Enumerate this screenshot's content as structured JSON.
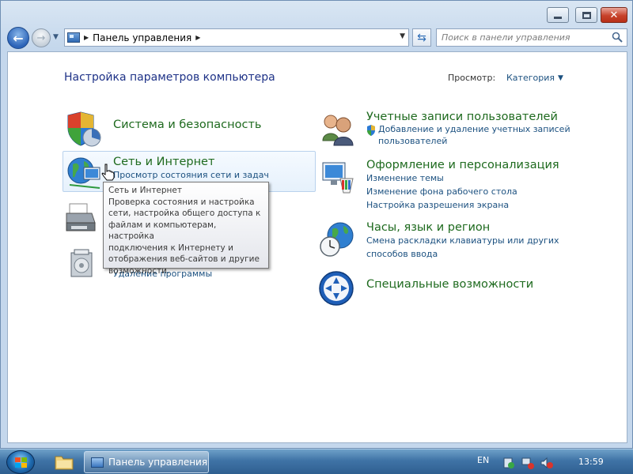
{
  "window": {
    "min_label": "minimize",
    "max_label": "maximize",
    "close_label": "close"
  },
  "nav": {
    "address_text": "Панель управления",
    "search_placeholder": "Поиск в панели управления"
  },
  "main": {
    "title": "Настройка параметров компьютера",
    "view_by_label": "Просмотр:",
    "view_by_value": "Категория"
  },
  "categories": [
    {
      "title": "Система и безопасность",
      "icon": "shield-pie-icon",
      "links": []
    },
    {
      "title": "Сеть и Интернет",
      "icon": "globe-network-icon",
      "links": [
        "Просмотр состояния сети и задач"
      ]
    },
    {
      "title": "",
      "icon": "printer-icon",
      "links": []
    },
    {
      "title": "",
      "icon": "programs-icon",
      "links": [
        "Удаление программы"
      ]
    },
    {
      "title": "Учетные записи пользователей",
      "icon": "users-icon",
      "links": [
        "Добавление и удаление учетных записей",
        "пользователей"
      ]
    },
    {
      "title": "Оформление и персонализация",
      "icon": "monitor-paint-icon",
      "links": [
        "Изменение темы",
        "Изменение фона рабочего стола",
        "Настройка разрешения экрана"
      ]
    },
    {
      "title": "Часы, язык и регион",
      "icon": "globe-clock-icon",
      "links": [
        "Смена раскладки клавиатуры или других",
        "способов ввода"
      ]
    },
    {
      "title": "Специальные возможности",
      "icon": "accessibility-icon",
      "links": []
    }
  ],
  "tooltip": {
    "lines": [
      "Сеть и Интернет",
      "Проверка состояния и настройка",
      "сети, настройка общего доступа к",
      "файлам и компьютерам, настройка",
      "подключения к Интернету и",
      "отображения веб-сайтов и другие",
      "возможности."
    ]
  },
  "taskbar": {
    "task_label": "Панель управления",
    "language": "EN",
    "clock": "13:59"
  },
  "colors": {
    "link": "#1c5180",
    "category_title": "#1e6a1e",
    "page_title": "#1e3287"
  }
}
